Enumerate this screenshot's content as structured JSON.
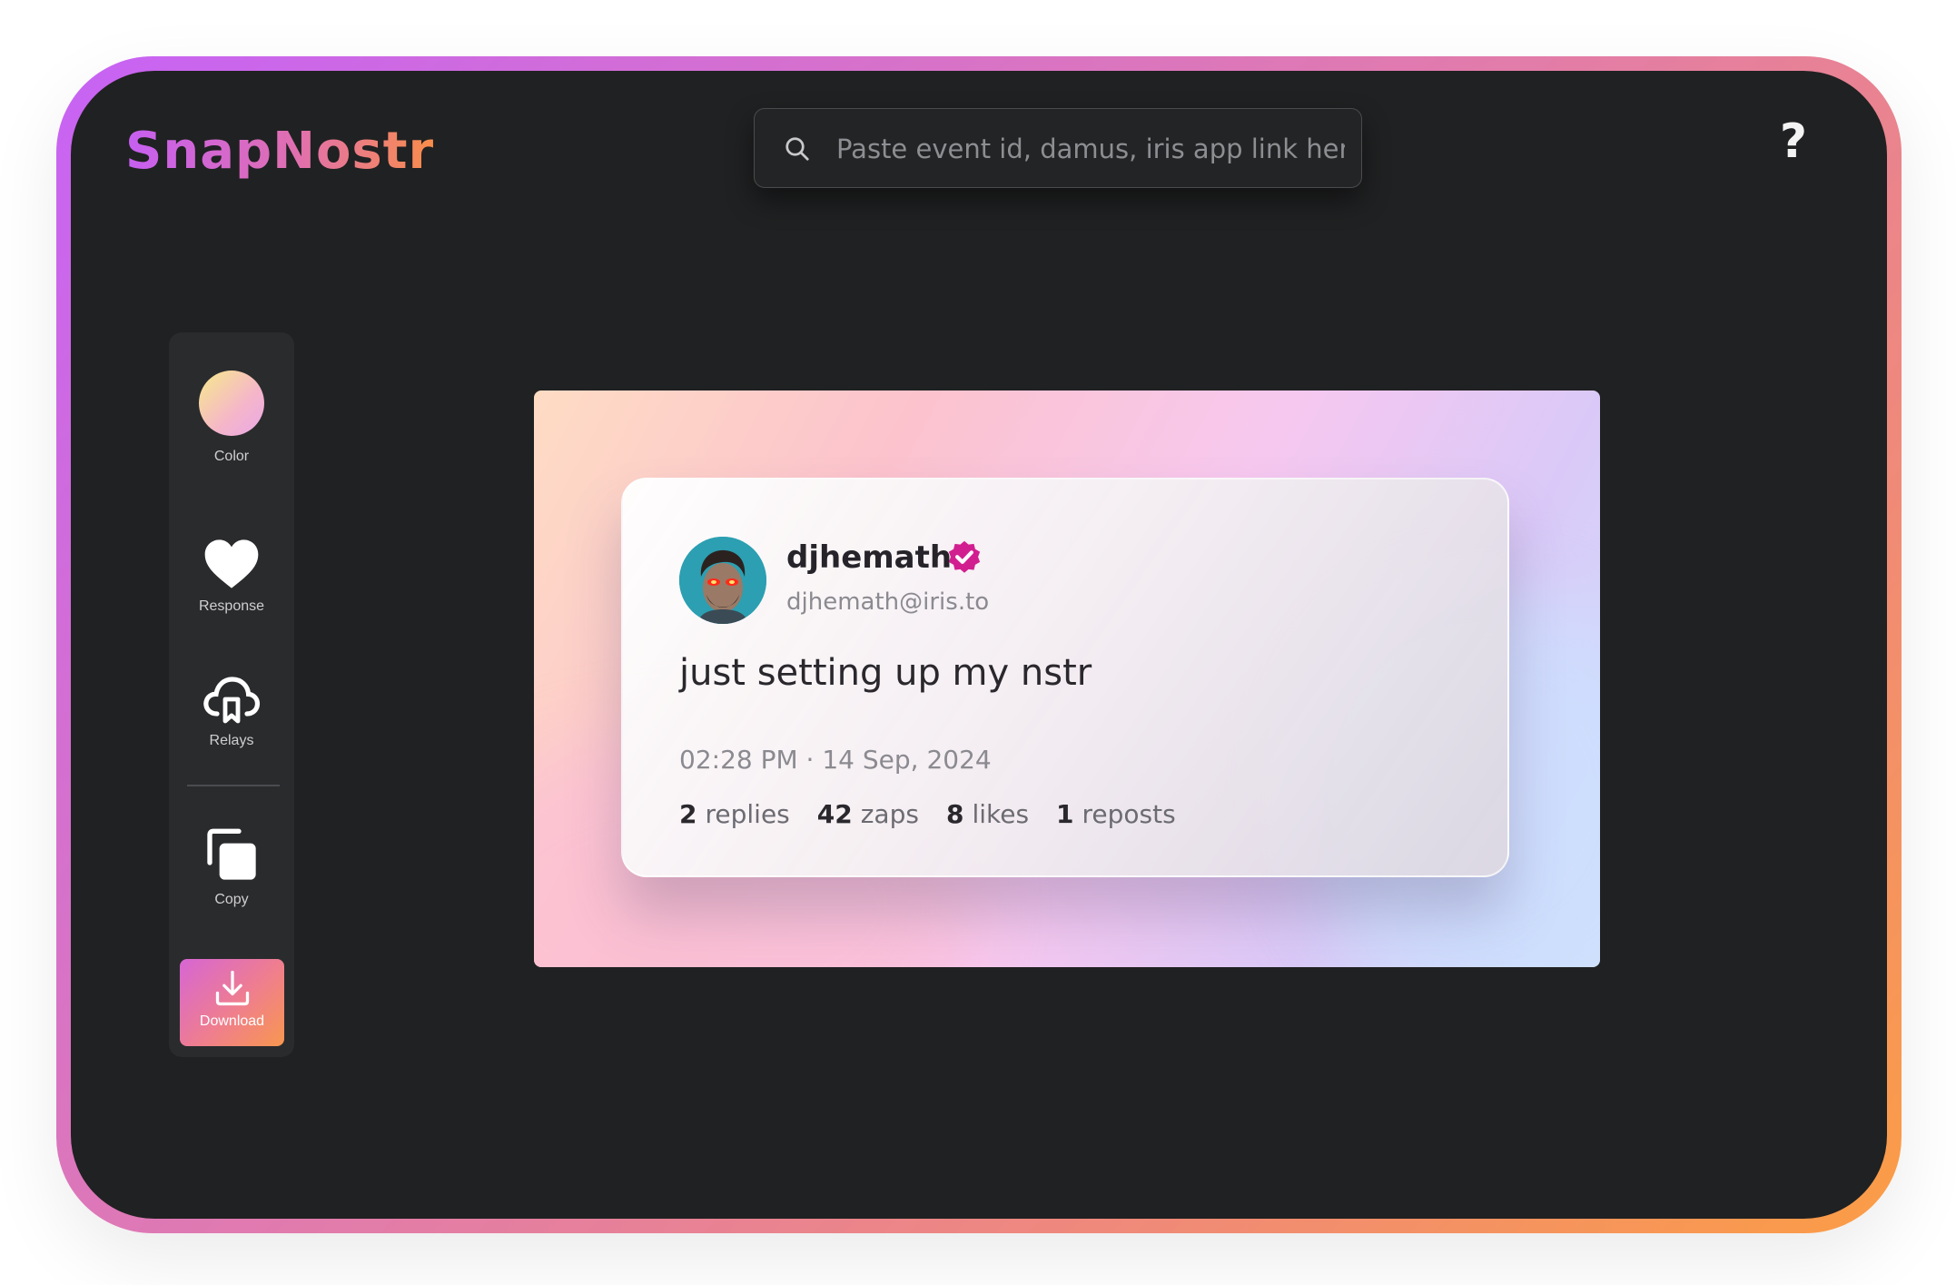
{
  "app": {
    "logo": "SnapNostr",
    "help_label": "?"
  },
  "search": {
    "placeholder": "Paste event id, damus, iris app link here",
    "value": ""
  },
  "toolbar": {
    "color_label": "Color",
    "response_label": "Response",
    "relays_label": "Relays",
    "copy_label": "Copy",
    "download_label": "Download"
  },
  "post": {
    "author_name": "djhemath",
    "author_handle": "djhemath@iris.to",
    "content": "just setting up my nstr",
    "timestamp": "02:28 PM · 14 Sep, 2024",
    "stats": {
      "replies_count": "2",
      "replies_label": "replies",
      "zaps_count": "42",
      "zaps_label": "zaps",
      "likes_count": "8",
      "likes_label": "likes",
      "reposts_count": "1",
      "reposts_label": "reposts"
    }
  },
  "icons": [
    "search-icon",
    "help-icon",
    "heart-icon",
    "cloud-relay-icon",
    "copy-icon",
    "download-icon",
    "verified-badge-icon"
  ],
  "colors": {
    "accent_start": "#c763f5",
    "accent_end": "#fb9d45",
    "app_bg": "#202122",
    "verified": "#d21f8f"
  }
}
